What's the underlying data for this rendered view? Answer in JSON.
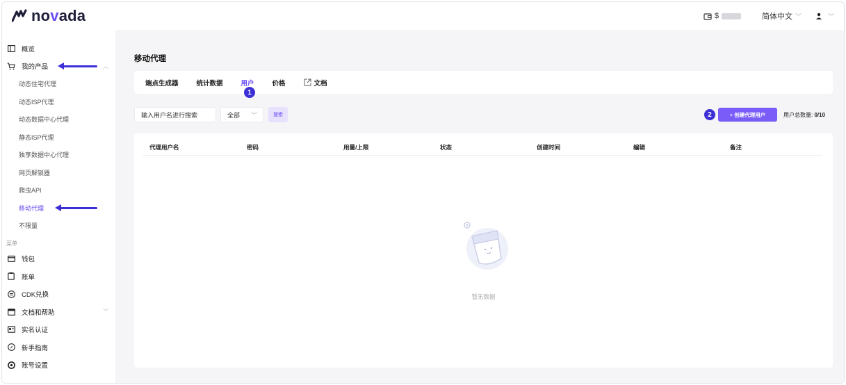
{
  "header": {
    "logo_text_prefix": "no",
    "logo_text_accent": "v",
    "logo_text_suffix": "ada",
    "balance_prefix": "$",
    "language": "简体中文",
    "icons": [
      "wallet-icon",
      "user-icon",
      "chevron-down-icon"
    ]
  },
  "sidebar": {
    "items": [
      {
        "label": "概览",
        "icon": "overview-icon"
      },
      {
        "label": "我的产品",
        "icon": "cart-icon",
        "expanded": true
      },
      {
        "label": "动态住宅代理",
        "sub": true
      },
      {
        "label": "动态ISP代理",
        "sub": true
      },
      {
        "label": "动态数据中心代理",
        "sub": true
      },
      {
        "label": "静态ISP代理",
        "sub": true
      },
      {
        "label": "独享数据中心代理",
        "sub": true
      },
      {
        "label": "网页解锁器",
        "sub": true
      },
      {
        "label": "爬虫API",
        "sub": true
      },
      {
        "label": "移动代理",
        "sub": true,
        "active": true
      },
      {
        "label": "不限量",
        "sub": true
      }
    ],
    "group_label": "菜单",
    "bottom_items": [
      {
        "label": "钱包",
        "icon": "wallet-icon"
      },
      {
        "label": "账单",
        "icon": "bill-icon"
      },
      {
        "label": "CDK兑换",
        "icon": "exchange-icon"
      },
      {
        "label": "文档和帮助",
        "icon": "doc-icon"
      },
      {
        "label": "实名认证",
        "icon": "id-card-icon"
      },
      {
        "label": "新手指南",
        "icon": "compass-icon"
      },
      {
        "label": "账号设置",
        "icon": "settings-icon"
      }
    ]
  },
  "main": {
    "page_title": "移动代理",
    "tabs": [
      {
        "label": "端点生成器"
      },
      {
        "label": "统计数据"
      },
      {
        "label": "用户",
        "active": true
      },
      {
        "label": "价格"
      },
      {
        "label": "文档",
        "icon": "external-link-icon"
      }
    ],
    "badge_1": "1",
    "badge_2": "2",
    "search": {
      "placeholder": "输入用户名进行搜索",
      "select_value": "全部",
      "button_label": "搜索"
    },
    "create_button_label": "+ 创建代理用户",
    "user_count_label": "用户总数量:",
    "user_count_value": "0/10",
    "table": {
      "columns": [
        "代理用户名",
        "密码",
        "用量/上限",
        "状态",
        "创建时间",
        "编辑",
        "备注"
      ],
      "empty_text": "暂无数据"
    }
  },
  "colors": {
    "accent": "#6a4df5",
    "annotation": "#3d2fd6",
    "button": "#7a5cf8"
  }
}
